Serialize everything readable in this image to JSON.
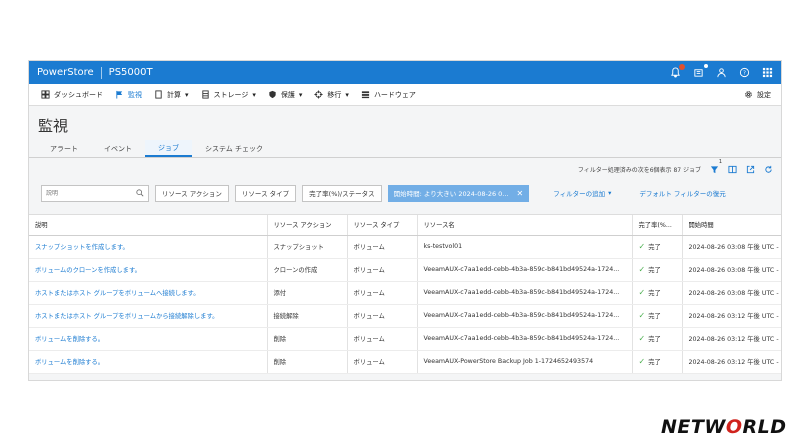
{
  "topbar": {
    "brand": "PowerStore",
    "system": "PS5000T"
  },
  "nav": [
    {
      "label": "ダッシュボード",
      "icon": "dashboard-icon",
      "active": false,
      "dropdown": false
    },
    {
      "label": "監視",
      "icon": "flag-icon",
      "active": true,
      "dropdown": false
    },
    {
      "label": "計算",
      "icon": "compute-icon",
      "active": false,
      "dropdown": true
    },
    {
      "label": "ストレージ",
      "icon": "storage-icon",
      "active": false,
      "dropdown": true
    },
    {
      "label": "保護",
      "icon": "shield-icon",
      "active": false,
      "dropdown": true
    },
    {
      "label": "移行",
      "icon": "migrate-icon",
      "active": false,
      "dropdown": true
    },
    {
      "label": "ハードウェア",
      "icon": "hardware-icon",
      "active": false,
      "dropdown": false
    }
  ],
  "settings_label": "設定",
  "page_title": "監視",
  "tabs": [
    {
      "label": "アラート",
      "active": false
    },
    {
      "label": "イベント",
      "active": false
    },
    {
      "label": "ジョブ",
      "active": true
    },
    {
      "label": "システム チェック",
      "active": false
    }
  ],
  "summary": "フィルター処理済みの次を6個表示 87 ジョブ",
  "filter_count": "1",
  "filters": {
    "search_placeholder": "説明",
    "buttons": [
      "リソース アクション",
      "リソース タイプ",
      "完了率(%)/ステータス"
    ],
    "chip_label": "開始時間: より大きい 2024-08-26 0...",
    "add_filter": "フィルターの追加",
    "restore_default": "デフォルト フィルターの復元"
  },
  "table": {
    "columns": [
      "説明",
      "リソース アクション",
      "リソース タイプ",
      "リソース名",
      "完了率(%...",
      "開始時間"
    ],
    "rows": [
      {
        "desc": "スナップショットを作成します。",
        "action": "スナップショット",
        "type": "ボリューム",
        "name": "ks-testvol01",
        "status": "完了",
        "start": "2024-08-26 03:08 午後 UTC -"
      },
      {
        "desc": "ボリュームのクローンを作成します。",
        "action": "クローンの作成",
        "type": "ボリューム",
        "name": "VeeamAUX-c7aa1edd-cebb-4b3a-859c-b841bd49524a-1724...",
        "status": "完了",
        "start": "2024-08-26 03:08 午後 UTC -"
      },
      {
        "desc": "ホストまたはホスト グループをボリュームへ接続します。",
        "action": "添付",
        "type": "ボリューム",
        "name": "VeeamAUX-c7aa1edd-cebb-4b3a-859c-b841bd49524a-1724...",
        "status": "完了",
        "start": "2024-08-26 03:08 午後 UTC -"
      },
      {
        "desc": "ホストまたはホスト グループをボリュームから接続解除します。",
        "action": "接続解除",
        "type": "ボリューム",
        "name": "VeeamAUX-c7aa1edd-cebb-4b3a-859c-b841bd49524a-1724...",
        "status": "完了",
        "start": "2024-08-26 03:12 午後 UTC -"
      },
      {
        "desc": "ボリュームを削除する。",
        "action": "削除",
        "type": "ボリューム",
        "name": "VeeamAUX-c7aa1edd-cebb-4b3a-859c-b841bd49524a-1724...",
        "status": "完了",
        "start": "2024-08-26 03:12 午後 UTC -"
      },
      {
        "desc": "ボリュームを削除する。",
        "action": "削除",
        "type": "ボリューム",
        "name": "VeeamAUX-PowerStore Backup Job 1-1724652493574",
        "status": "完了",
        "start": "2024-08-26 03:12 午後 UTC -"
      }
    ]
  },
  "logo_text": "NETWORLD",
  "colors": {
    "accent": "#1b7bd1",
    "chip": "#72aee6",
    "success": "#4caf50",
    "notify": "#e0502e",
    "logo_red": "#d0231d"
  }
}
